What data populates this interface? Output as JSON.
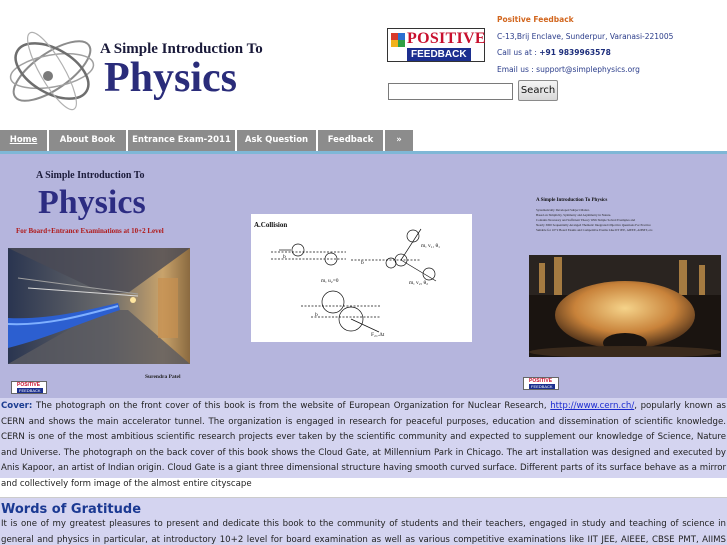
{
  "header": {
    "logo_line1": "A Simple Introduction To",
    "logo_line2": "Physics",
    "badge_positive": "POSITIVE",
    "badge_feedback": "FEEDBACK",
    "contact": {
      "title": "Positive Feedback",
      "address": "C-13,Brij Enclave, Sunderpur, Varanasi-221005",
      "call_label": "Call us at : ",
      "phone": "+91 9839963578",
      "email_label": "Email us : ",
      "email": "support@simplephysics.org"
    },
    "search": {
      "value": "",
      "button_label": "Search"
    }
  },
  "nav": {
    "tabs": [
      {
        "label": "Home"
      },
      {
        "label": "About Book"
      },
      {
        "label": "Entrance Exam-2011"
      },
      {
        "label": "Ask Question"
      },
      {
        "label": "Feedback"
      },
      {
        "label": "»"
      }
    ]
  },
  "banner": {
    "front_cover": {
      "line1": "A Simple Introduction To",
      "line2": "Physics",
      "subtitle": "For Board+Entrance Examinations at 10+2 Level",
      "author": "Surendra Patel"
    },
    "diagram": {
      "title": "A.Collision"
    },
    "back_cover": {
      "title": "A Simple Introduction To Physics",
      "lines": [
        "Systematically Developed Subject Matter.",
        "Based on Simplicity, Symmetry and Asymmetry in Nature.",
        "Contains Necessary and Sufficient Theory With Simple Solved Examples and",
        "Nearly 3000 Sequentially Arranged Thematic Integrated Objective Questions For Practice",
        "Suitable for 10+2 Board Exams and Competitive Exams Like IIT JEE, AIEEE, AIPMT, etc."
      ]
    },
    "mini_logo_top": "POSITIVE",
    "mini_logo_bottom": "FEEDBACK"
  },
  "cover_text": {
    "label": "Cover:",
    "part1": " The photograph on the front cover of this book is from the website of European Organization for Nuclear Research, ",
    "link": "http://www.cern.ch/",
    "part2": ", popularly known as CERN and shows the main accelerator tunnel. The organization is engaged in research for peaceful purposes, education and dissemination of scientific knowledge. CERN is one of the most ambitious scientific research projects ever taken by the scientific community and expected to supplement our knowledge of Science, Nature and Universe. The photograph on the back cover of this book shows the Cloud Gate, at Millennium Park in Chicago. The art installation was designed and executed by Anis Kapoor, an artist of Indian origin. Cloud Gate is a giant three dimensional structure having smooth curved surface. Different parts of its surface behave as a mirror and collectively form image of the almost entire cityscape"
  },
  "gratitude": {
    "heading": "Words of Gratitude",
    "text": "It is one of my greatest pleasures to present and dedicate this book to the community of students and their teachers, engaged in study and teaching of science in general and physics in particular, at introductory 10+2 level for board examination as well as various competitive examinations like IIT JEE, AIEEE, CBSE PMT, AIIMS Entrance etc. It will be"
  },
  "colors": {
    "nav_tab": "#8c8c8c",
    "banner_bg": "#b5b5dd",
    "text_bg": "#d4d4f0",
    "heading": "#1b3992",
    "link": "#1b2bcf"
  }
}
